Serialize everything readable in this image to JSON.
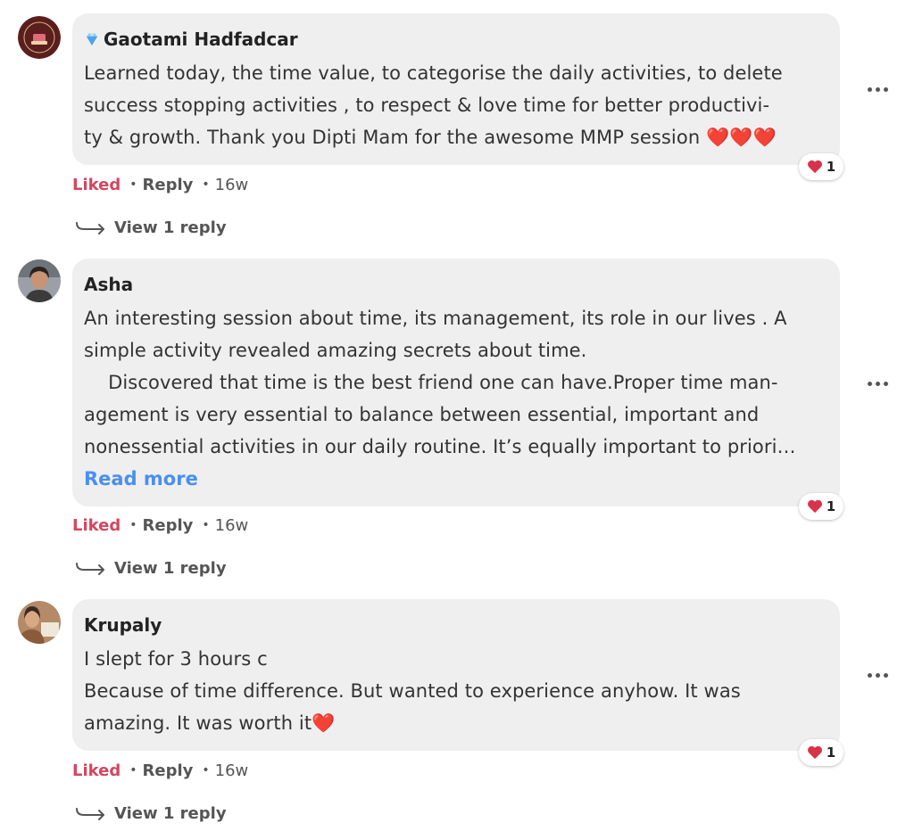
{
  "comments": [
    {
      "author": "Gaotami Hadfadcar",
      "lines": [
        "Learned today, the time value, to categorise the daily activities, to delete",
        "success stopping  activities , to respect & love  time for better productivi-",
        "ty & growth. Thank you Dipti Mam for the awesome MMP session  ❤️❤️❤️"
      ],
      "reaction_count": "1",
      "liked": "Liked",
      "reply": "Reply",
      "time": "16w",
      "view_reply": "View 1 reply"
    },
    {
      "author": "Asha",
      "lines": [
        "An interesting session about time, its management, its role in our lives . A",
        "simple activity revealed amazing secrets about time.",
        "    Discovered that time is the best friend one can have.Proper time man-",
        "agement is very essential to balance between essential, important and",
        "nonessential activities in our daily routine. It’s equally important to priori…"
      ],
      "read_more": "Read more",
      "reaction_count": "1",
      "liked": "Liked",
      "reply": "Reply",
      "time": "16w",
      "view_reply": "View 1 reply"
    },
    {
      "author": "Krupaly",
      "lines": [
        "I slept for 3 hours c",
        "Because of time difference. But wanted to experience anyhow. It was",
        "amazing. It was worth it❤️"
      ],
      "reaction_count": "1",
      "liked": "Liked",
      "reply": "Reply",
      "time": "16w",
      "view_reply": "View 1 reply"
    }
  ],
  "colors": {
    "liked": "#d64560",
    "read_more": "#4a8ff0",
    "bubble": "#efefef",
    "heart": "#d8334a"
  },
  "icons": [
    "diamond-icon",
    "heart-icon",
    "more-options-icon",
    "reply-arrow-icon"
  ]
}
